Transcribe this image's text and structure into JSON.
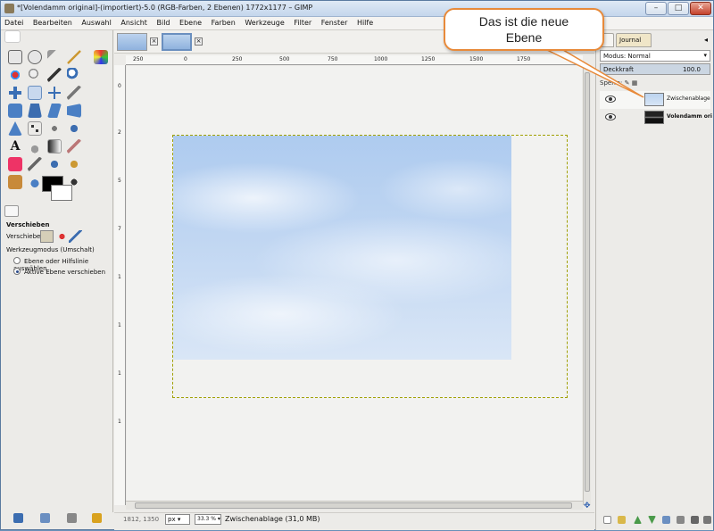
{
  "window": {
    "title": "*[Volendamm original]-(importiert)-5.0 (RGB-Farben, 2 Ebenen) 1772x1177 – GIMP",
    "minimize": "–",
    "maximize": "□",
    "close": "✕"
  },
  "menu": [
    "Datei",
    "Bearbeiten",
    "Auswahl",
    "Ansicht",
    "Bild",
    "Ebene",
    "Farben",
    "Werkzeuge",
    "Filter",
    "Fenster",
    "Hilfe"
  ],
  "tool_options": {
    "title": "Verschieben",
    "move_label": "Verschieben:",
    "mode_label": "Werkzeugmodus (Umschalt)",
    "radio_1": "Ebene oder Hilfslinie auswählen",
    "radio_2": "Aktive Ebene verschieben"
  },
  "ruler": {
    "top": [
      "250",
      "0",
      "250",
      "500",
      "750",
      "1000",
      "1250",
      "1500",
      "1750"
    ],
    "left": [
      "0",
      "2",
      "5",
      "7",
      "1",
      "1",
      "1",
      "1"
    ]
  },
  "status": {
    "coords": "1812, 1350",
    "unit": "px",
    "zoom": "33.3 %",
    "message": "Zwischenablage (31,0 MB)"
  },
  "dock": {
    "journal_tab": "Journal",
    "mode": "Modus: Normal",
    "opacity_label": "Deckkraft",
    "opacity_value": "100.0",
    "lock_label": "Sperre:",
    "layers": [
      {
        "name": "Zwischenablage"
      },
      {
        "name": "Volendamm ori"
      }
    ]
  },
  "callout": {
    "line1": "Das ist die neue",
    "line2": "Ebene"
  },
  "colors": {
    "accent": "#e88a3a",
    "sky": "#aecbef",
    "layer_border": "#a0a000"
  }
}
